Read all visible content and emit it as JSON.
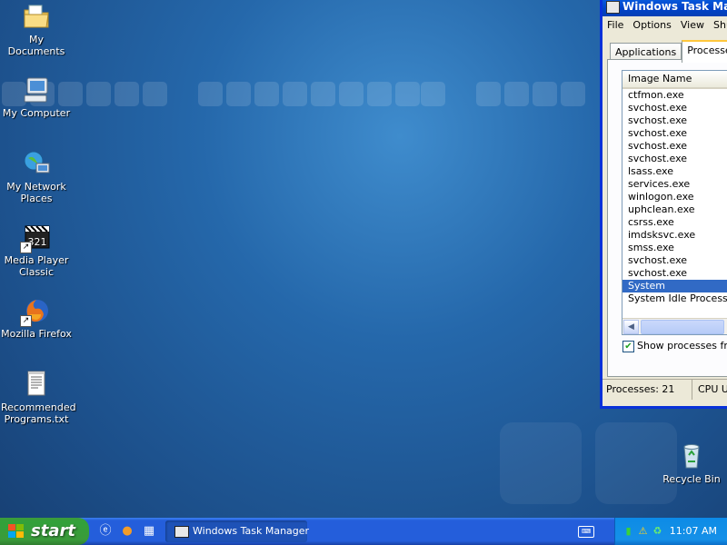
{
  "desktop": {
    "icons": [
      {
        "label": "My Documents",
        "icon": "my-documents-icon"
      },
      {
        "label": "My Computer",
        "icon": "my-computer-icon"
      },
      {
        "label": "My Network Places",
        "icon": "network-places-icon"
      },
      {
        "label": "Media Player Classic",
        "icon": "media-player-icon"
      },
      {
        "label": "Mozilla Firefox",
        "icon": "firefox-icon"
      },
      {
        "label": "Recommended Programs.txt",
        "icon": "text-file-icon"
      }
    ],
    "recycle_bin": {
      "label": "Recycle Bin",
      "icon": "recycle-bin-icon"
    }
  },
  "task_manager": {
    "title": "Windows Task Manag",
    "menu": [
      "File",
      "Options",
      "View",
      "Shut"
    ],
    "tabs": [
      "Applications",
      "Processes"
    ],
    "active_tab": "Processes",
    "column_header": "Image Name",
    "processes": [
      "ctfmon.exe",
      "svchost.exe",
      "svchost.exe",
      "svchost.exe",
      "svchost.exe",
      "svchost.exe",
      "lsass.exe",
      "services.exe",
      "winlogon.exe",
      "uphclean.exe",
      "csrss.exe",
      "imdsksvc.exe",
      "smss.exe",
      "svchost.exe",
      "svchost.exe",
      "System",
      "System Idle Process"
    ],
    "selected_process": "System",
    "show_all_label": "Show processes from",
    "show_all_checked": true,
    "status_processes": "Processes: 21",
    "status_cpu": "CPU Usa"
  },
  "taskbar": {
    "start_label": "start",
    "quick_launch": [
      "ie-icon",
      "firefox-icon",
      "media-player-icon"
    ],
    "task_button": "Windows Task Manager",
    "clock": "11:07 AM"
  },
  "colors": {
    "desktop": "#2568ab",
    "taskbar": "#245edb",
    "title_bar": "#0a5fe0",
    "selection": "#316ac5",
    "start_button": "#3a9b3a"
  }
}
